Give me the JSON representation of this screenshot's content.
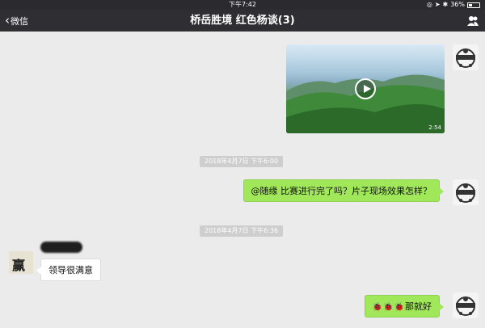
{
  "status_bar": {
    "time": "下午7:42",
    "battery": "36%",
    "battery_level": 0.36
  },
  "nav": {
    "back_label": "微信",
    "title": "桥岳胜境 红色杨谈(3)"
  },
  "video": {
    "duration": "2:54"
  },
  "messages": {
    "timestamp_1": "2018年4月7日 下午6:00",
    "msg_1": "@随缘 比赛进行完了吗？片子现场效果怎样？",
    "timestamp_2": "2018年4月7日 下午6:36",
    "sender_name": "",
    "avatar_text": "赢",
    "msg_2": "领导很满意",
    "msg_3_text": "那就好"
  },
  "colors": {
    "my_bubble": "#a0e75a",
    "nav_bg": "#2f2f33",
    "chat_bg": "#ebebeb"
  }
}
